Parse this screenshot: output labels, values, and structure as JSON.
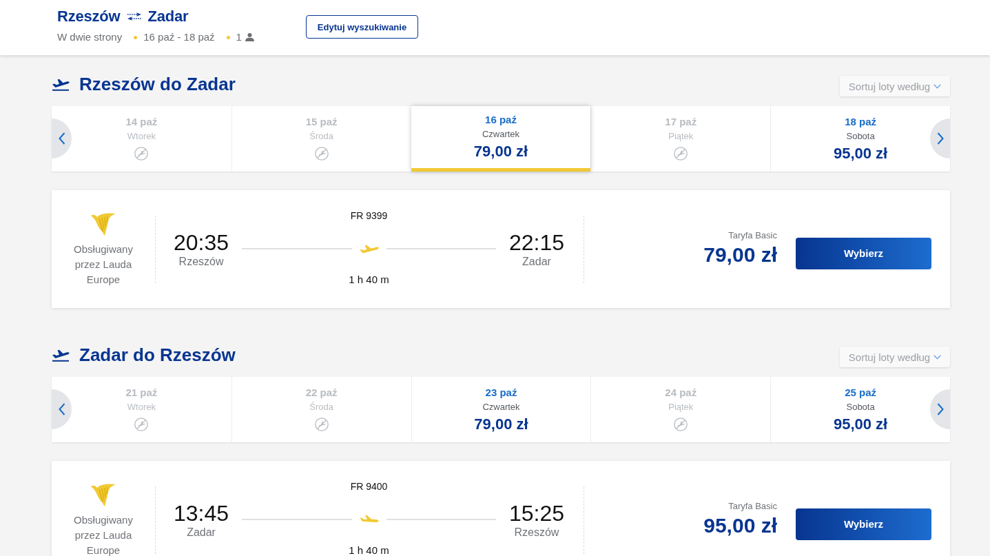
{
  "header": {
    "origin": "Rzeszów",
    "destination": "Zadar",
    "trip_type": "W dwie strony",
    "dates": "16 paź - 18 paź",
    "passengers": "1",
    "edit_button": "Edytuj wyszukiwanie"
  },
  "legs": [
    {
      "title": "Rzeszów do Zadar",
      "sort": "Sortuj loty według",
      "dates": [
        {
          "date": "14 paź",
          "day": "Wtorek",
          "available": false,
          "selected": false
        },
        {
          "date": "15 paź",
          "day": "Środa",
          "available": false,
          "selected": false
        },
        {
          "date": "16 paź",
          "day": "Czwartek",
          "price": "79,00 zł",
          "available": true,
          "selected": true
        },
        {
          "date": "17 paź",
          "day": "Piątek",
          "available": false,
          "selected": false
        },
        {
          "date": "18 paź",
          "day": "Sobota",
          "price": "95,00 zł",
          "available": true,
          "selected": false
        }
      ],
      "flight": {
        "operator": "Obsługiwany przez Lauda Europe",
        "flight_number": "FR 9399",
        "departure_time": "20:35",
        "departure_city": "Rzeszów",
        "arrival_time": "22:15",
        "arrival_city": "Zadar",
        "duration": "1 h 40 m",
        "fare": "Taryfa Basic",
        "price": "79,00 zł",
        "button": "Wybierz"
      }
    },
    {
      "title": "Zadar do Rzeszów",
      "sort": "Sortuj loty według",
      "dates": [
        {
          "date": "21 paź",
          "day": "Wtorek",
          "available": false,
          "selected": false
        },
        {
          "date": "22 paź",
          "day": "Środa",
          "available": false,
          "selected": false
        },
        {
          "date": "23 paź",
          "day": "Czwartek",
          "price": "79,00 zł",
          "available": true,
          "selected": false
        },
        {
          "date": "24 paź",
          "day": "Piątek",
          "available": false,
          "selected": false
        },
        {
          "date": "25 paź",
          "day": "Sobota",
          "price": "95,00 zł",
          "available": true,
          "selected": false
        }
      ],
      "flight": {
        "operator": "Obsługiwany przez Lauda Europe",
        "flight_number": "FR 9400",
        "departure_time": "13:45",
        "departure_city": "Zadar",
        "arrival_time": "15:25",
        "arrival_city": "Rzeszów",
        "duration": "1 h 40 m",
        "fare": "Taryfa Basic",
        "price": "95,00 zł",
        "button": "Wybierz"
      }
    }
  ]
}
